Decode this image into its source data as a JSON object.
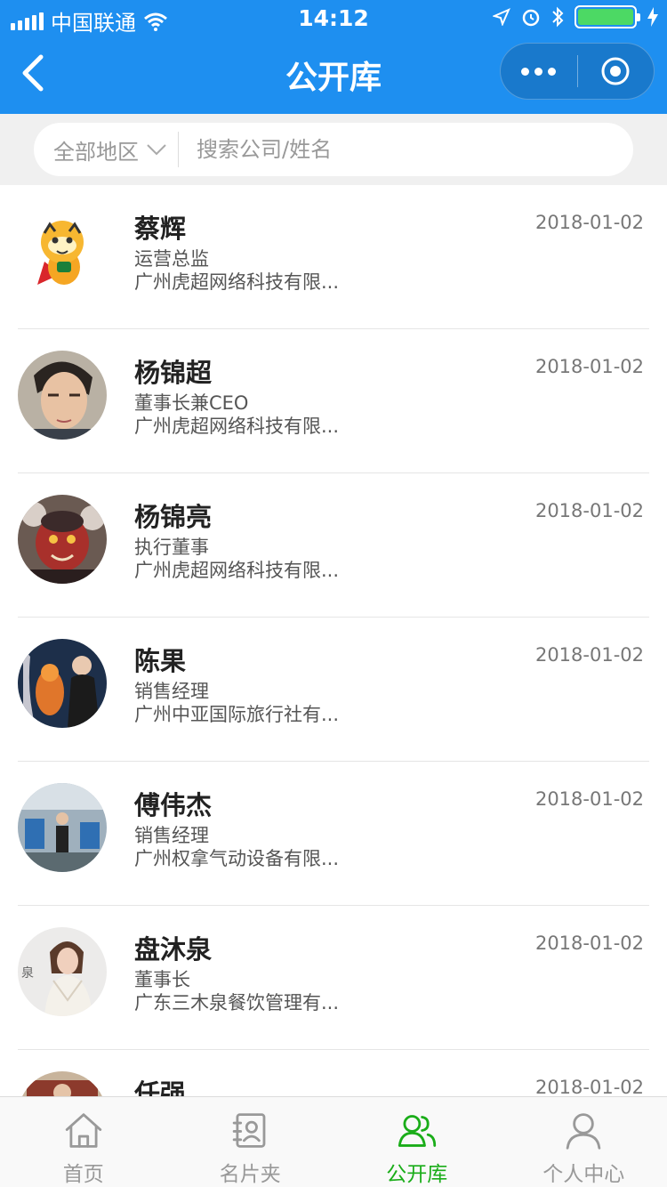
{
  "status_bar": {
    "carrier": "中国联通",
    "time": "14:12"
  },
  "nav": {
    "title": "公开库"
  },
  "search": {
    "region": "全部地区",
    "placeholder": "搜索公司/姓名"
  },
  "contacts": [
    {
      "name": "蔡辉",
      "title": "运营总监",
      "company": "广州虎超网络科技有限...",
      "date": "2018-01-02",
      "avatar": "tiger-mascot"
    },
    {
      "name": "杨锦超",
      "title": "董事长兼CEO",
      "company": "广州虎超网络科技有限...",
      "date": "2018-01-02",
      "avatar": "man-portrait"
    },
    {
      "name": "杨锦亮",
      "title": "执行董事",
      "company": "广州虎超网络科技有限...",
      "date": "2018-01-02",
      "avatar": "masked-figure"
    },
    {
      "name": "陈果",
      "title": "销售经理",
      "company": "广州中亚国际旅行社有...",
      "date": "2018-01-02",
      "avatar": "people-with-statue"
    },
    {
      "name": "傅伟杰",
      "title": "销售经理",
      "company": "广州权拿气动设备有限...",
      "date": "2018-01-02",
      "avatar": "man-at-factory"
    },
    {
      "name": "盘沐泉",
      "title": "董事长",
      "company": "广东三木泉餐饮管理有...",
      "date": "2018-01-02",
      "avatar": "woman-portrait"
    },
    {
      "name": "任强",
      "title": "",
      "company": "",
      "date": "2018-01-02",
      "avatar": "photo"
    }
  ],
  "tabbar": [
    {
      "label": "首页",
      "icon": "home-icon",
      "active": false
    },
    {
      "label": "名片夹",
      "icon": "card-holder-icon",
      "active": false
    },
    {
      "label": "公开库",
      "icon": "public-library-icon",
      "active": true
    },
    {
      "label": "个人中心",
      "icon": "person-icon",
      "active": false
    }
  ],
  "colors": {
    "header_blue": "#1e8ff0",
    "active_green": "#1aad19",
    "battery_green": "#4cd964"
  }
}
